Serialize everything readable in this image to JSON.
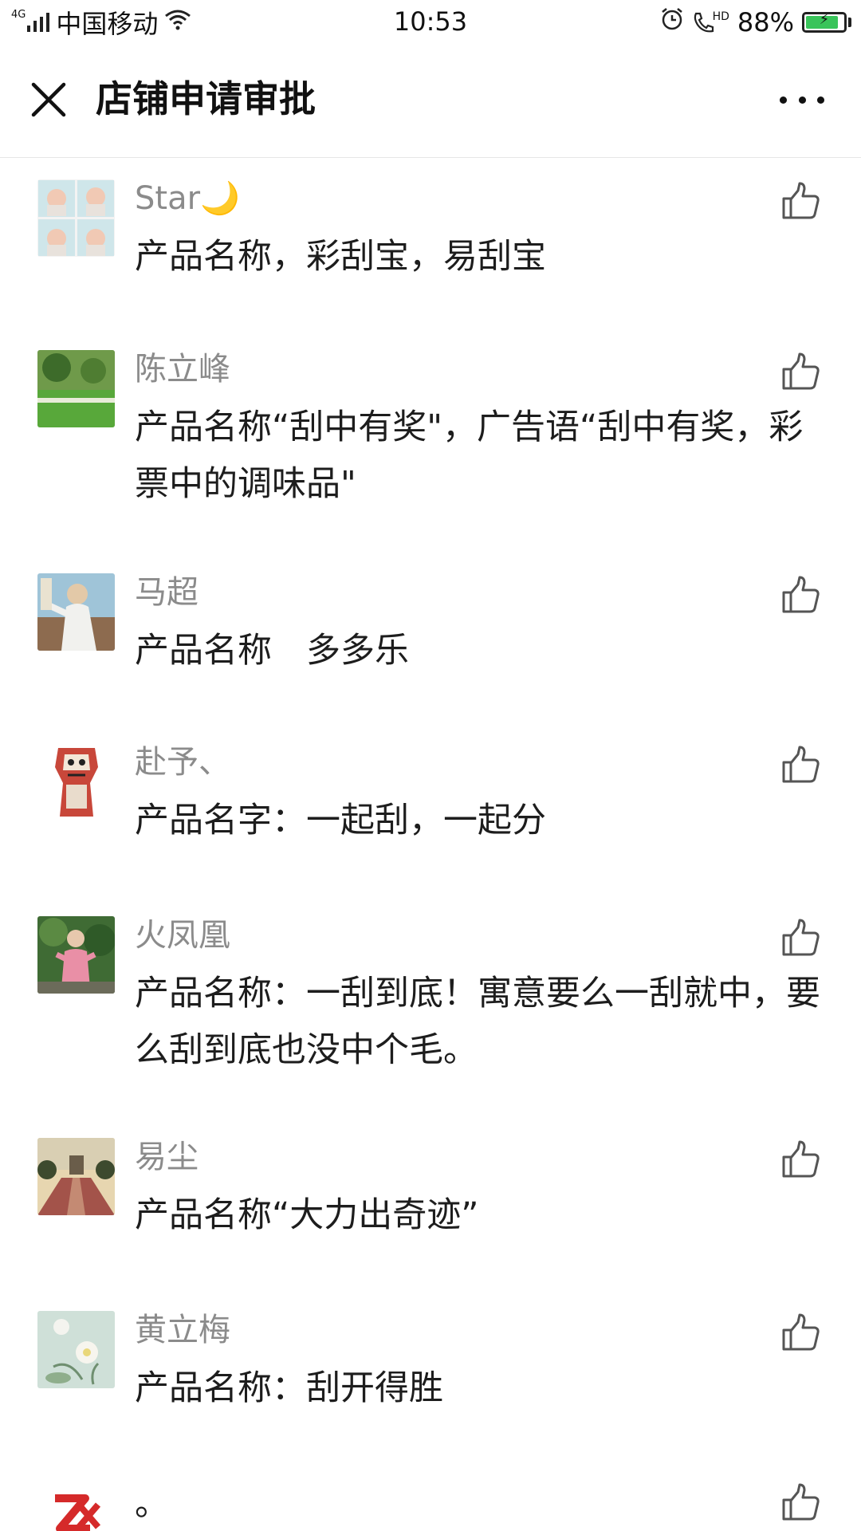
{
  "status_bar": {
    "network": "4G",
    "carrier": "中国移动",
    "time": "10:53",
    "hd": "HD",
    "battery": "88%",
    "battery_level": 0.88,
    "battery_color": "#39c45a"
  },
  "nav": {
    "title": "店铺申请审批",
    "close_icon": "close-icon",
    "more_icon": "more-icon"
  },
  "comments": [
    {
      "author": "Star🌙",
      "content": "产品名称，彩刮宝，易刮宝",
      "avatar": "baby-photo-grid"
    },
    {
      "author": "陈立峰",
      "content": "产品名称“刮中有奖\"，广告语“刮中有奖，彩票中的调味品\"",
      "avatar": "park-landscape"
    },
    {
      "author": "马超",
      "content": "产品名称　多多乐",
      "avatar": "person-portrait"
    },
    {
      "author": "赴予、",
      "content": "产品名字：一起刮，一起分",
      "avatar": "tiger-totem"
    },
    {
      "author": "火凤凰",
      "content": "产品名称：一刮到底！寓意要么一刮就中，要么刮到底也没中个毛。",
      "avatar": "child-photo"
    },
    {
      "author": "易尘",
      "content": "产品名称“大力出奇迹”",
      "avatar": "temple-path"
    },
    {
      "author": "黄立梅",
      "content": "产品名称：刮开得胜",
      "avatar": "lotus-painting"
    },
    {
      "author": "",
      "content": "。",
      "avatar": "zx-logo"
    }
  ]
}
